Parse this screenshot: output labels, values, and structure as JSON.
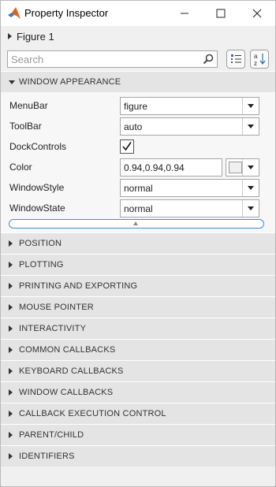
{
  "window": {
    "title": "Property Inspector",
    "minimize_icon": "minimize-icon",
    "maximize_icon": "maximize-icon",
    "close_icon": "close-icon",
    "app_icon": "matlab-logo-icon"
  },
  "breadcrumb": {
    "label": "Figure 1"
  },
  "search": {
    "placeholder": "Search",
    "value": ""
  },
  "toolbar": {
    "categorized_icon": "list-view-icon",
    "sort_icon": "sort-az-icon"
  },
  "sections": {
    "window_appearance": "WINDOW APPEARANCE",
    "collapsed": [
      "POSITION",
      "PLOTTING",
      "PRINTING AND EXPORTING",
      "MOUSE POINTER",
      "INTERACTIVITY",
      "COMMON CALLBACKS",
      "KEYBOARD CALLBACKS",
      "WINDOW CALLBACKS",
      "CALLBACK EXECUTION CONTROL",
      "PARENT/CHILD",
      "IDENTIFIERS"
    ]
  },
  "properties": {
    "menubar": {
      "label": "MenuBar",
      "value": "figure"
    },
    "toolbar": {
      "label": "ToolBar",
      "value": "auto"
    },
    "dockcontrols": {
      "label": "DockControls",
      "checked": true
    },
    "color": {
      "label": "Color",
      "value": "0.94,0.94,0.94",
      "swatch": "#f0f0f0"
    },
    "windowstyle": {
      "label": "WindowStyle",
      "value": "normal"
    },
    "windowstate": {
      "label": "WindowState",
      "value": "normal"
    }
  },
  "colors": {
    "focus_accent": "#3d8ee8",
    "header_bg": "#e4e4e4"
  }
}
